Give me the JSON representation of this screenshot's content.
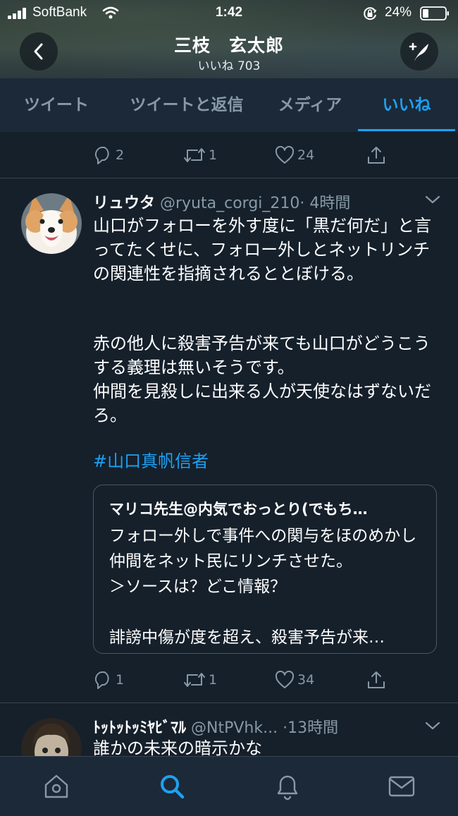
{
  "status_bar": {
    "carrier": "SoftBank",
    "time": "1:42",
    "battery": "24%"
  },
  "header": {
    "name": "三枝　玄太郎",
    "likes": "いいね 703",
    "back_icon": "chevron-left-icon",
    "compose_icon": "quill-plus-icon"
  },
  "tabs": [
    {
      "label": "ツイート",
      "active": false
    },
    {
      "label": "ツイートと返信",
      "active": false
    },
    {
      "label": "メディア",
      "active": false
    },
    {
      "label": "いいね",
      "active": true
    }
  ],
  "prev_tweet_actions": {
    "replies": "2",
    "retweets": "1",
    "likes": "24"
  },
  "tweet": {
    "name": "リュウタ",
    "handle": "@ryuta_corgi_210",
    "time": "· 4時間",
    "body_1": "山口がフォローを外す度に「黒だ何だ」と言ってたくせに、フォロー外しとネットリンチの関連性を指摘されるととぼける。",
    "body_2": "赤の他人に殺害予告が来ても山口がどうこうする義理は無いそうです。\n仲間を見殺しに出来る人が天使なはずないだろ。",
    "hashtag": "#山口真帆信者",
    "quote": {
      "author": "マリコ先生@内気でおっとり(でもち…",
      "text": "フォロー外しで事件への関与をほのめかし仲間をネット民にリンチさせた。\n＞ソースは？どこ情報？\n\n誹謗中傷が度を超え、殺害予告が来…"
    },
    "actions": {
      "replies": "1",
      "retweets": "1",
      "likes": "34"
    }
  },
  "next_tweet": {
    "name": "ﾄｯﾄｯﾄｯﾐﾔﾋﾞﾏﾙ",
    "handle": "@NtPVhk...",
    "time": "·13時間",
    "body": "誰かの未来の暗示かな"
  },
  "bottom_nav": [
    {
      "icon": "home-icon",
      "active": false
    },
    {
      "icon": "search-icon",
      "active": true
    },
    {
      "icon": "bell-icon",
      "active": false
    },
    {
      "icon": "mail-icon",
      "active": false
    }
  ],
  "colors": {
    "background": "#15202b",
    "accent": "#1da1f2",
    "muted": "#8899a6"
  }
}
